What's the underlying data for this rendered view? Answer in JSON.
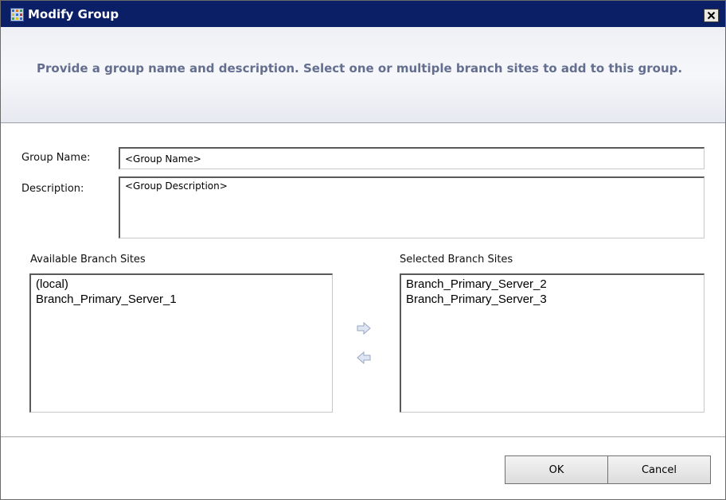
{
  "window": {
    "title": "Modify Group",
    "close_glyph": "×"
  },
  "header": {
    "instructions": "Provide a group name and description. Select one or multiple branch sites to add to this group."
  },
  "form": {
    "group_name_label": "Group Name:",
    "group_name_value": "<Group Name>",
    "description_label": "Description:",
    "description_value": "<Group Description>"
  },
  "available": {
    "label": "Available Branch Sites",
    "items": [
      "(local)",
      "Branch_Primary_Server_1"
    ]
  },
  "selected": {
    "label": "Selected Branch Sites",
    "items": [
      "Branch_Primary_Server_2",
      "Branch_Primary_Server_3"
    ]
  },
  "buttons": {
    "ok": "OK",
    "cancel": "Cancel"
  },
  "icons": {
    "app": "app-grid-icon",
    "add": "arrow-right-icon",
    "remove": "arrow-left-icon",
    "close": "close-icon"
  },
  "colors": {
    "titlebar": "#0a1f66",
    "instructions_text": "#646e8f"
  }
}
